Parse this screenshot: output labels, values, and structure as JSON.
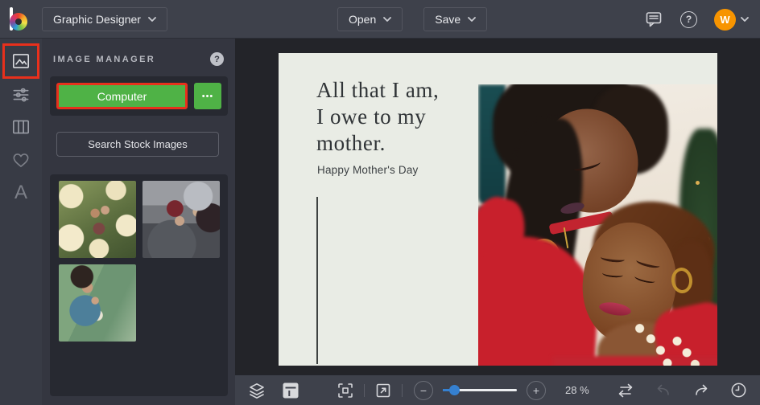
{
  "topbar": {
    "app_title": "Graphic Designer",
    "open_label": "Open",
    "save_label": "Save",
    "avatar_initial": "W"
  },
  "sidebar": {
    "icons": [
      "image-manager-icon",
      "adjustments-icon",
      "layout-columns-icon",
      "favorites-heart-icon",
      "text-tool-icon"
    ],
    "active_item": "image-manager"
  },
  "panel": {
    "title": "IMAGE MANAGER",
    "help_glyph": "?",
    "computer_button": "Computer",
    "more_button": "•••",
    "search_button": "Search Stock Images",
    "thumbnails": [
      "mother-child-roses",
      "mother-child-winter",
      "mother-child-stream"
    ]
  },
  "card": {
    "headline": [
      "All that I am,",
      "I owe to my",
      "mother."
    ],
    "subtitle": "Happy Mother's Day"
  },
  "toolbar": {
    "zoom_value": "28 %",
    "minus_glyph": "−",
    "plus_glyph": "+"
  },
  "colors": {
    "accent_green": "#4fb246",
    "highlight_red": "#e8301c",
    "slider_blue": "#3580d0",
    "avatar_orange": "#f79400",
    "card_background": "#e9ece5"
  }
}
